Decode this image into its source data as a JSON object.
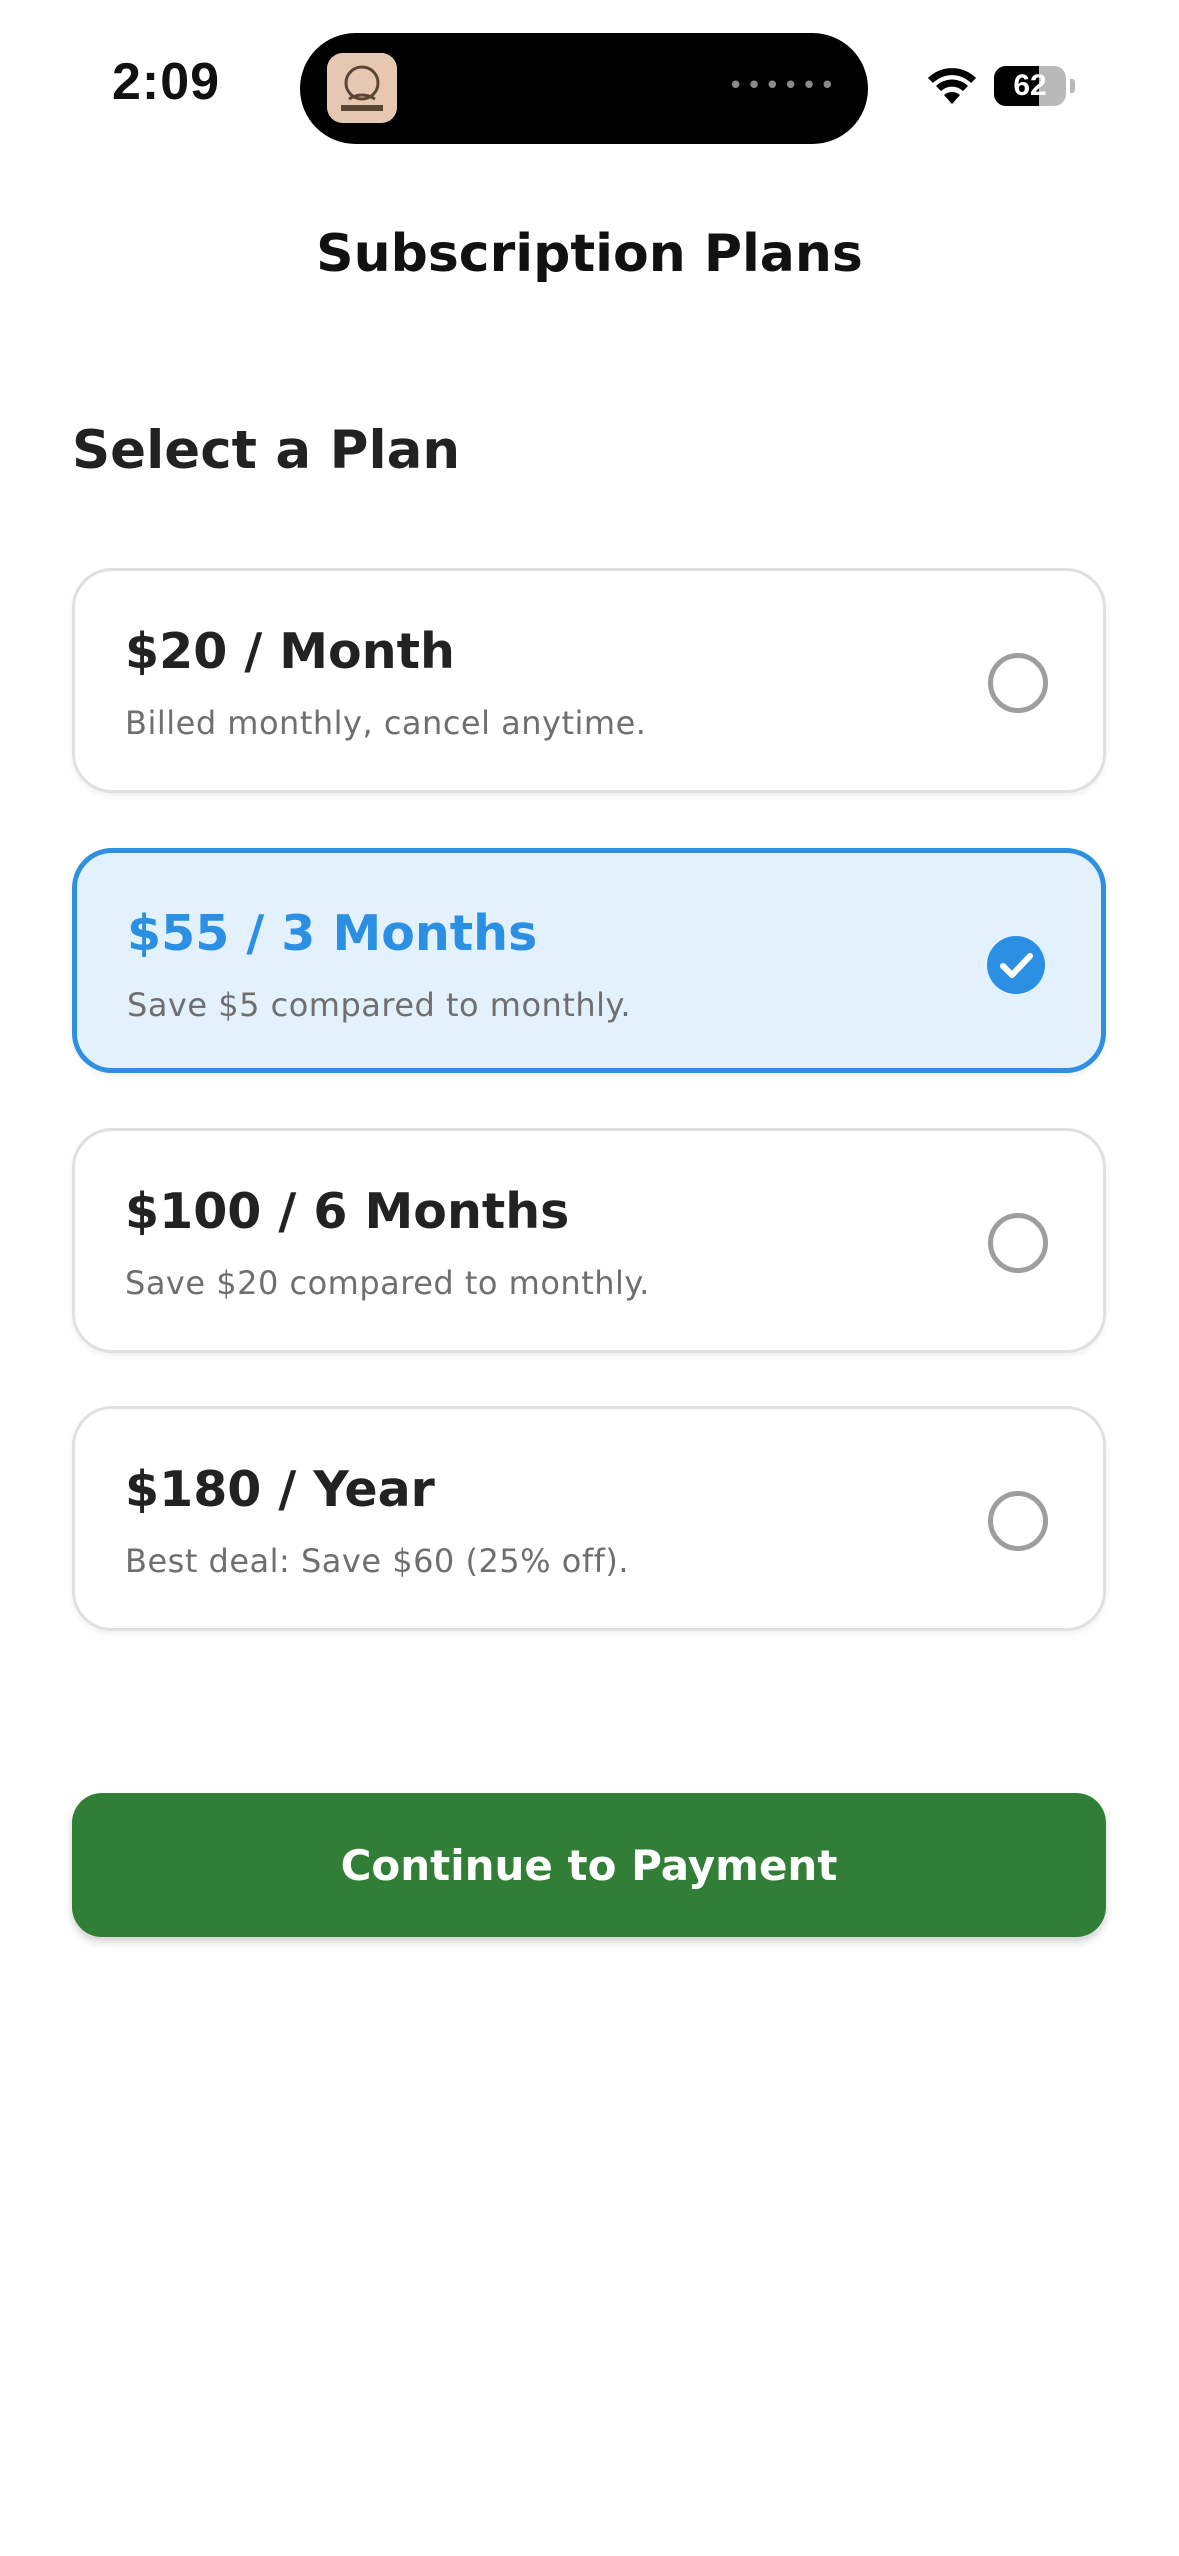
{
  "status_bar": {
    "time": "2:09",
    "battery_level": "62",
    "battery_fraction": 0.62,
    "icons": [
      "app-icon",
      "wifi-icon",
      "battery-icon"
    ]
  },
  "header": {
    "title": "Subscription Plans"
  },
  "section": {
    "title": "Select a Plan"
  },
  "plans": [
    {
      "name": "$20 / Month",
      "description": "Billed monthly, cancel anytime.",
      "selected": false
    },
    {
      "name": "$55 / 3 Months",
      "description": "Save $5 compared to monthly.",
      "selected": true
    },
    {
      "name": "$100 / 6 Months",
      "description": "Save $20 compared to monthly.",
      "selected": false
    },
    {
      "name": "$180 / Year",
      "description": "Best deal: Save $60 (25% off).",
      "selected": false
    }
  ],
  "actions": {
    "continue_label": "Continue to Payment"
  },
  "colors": {
    "accent": "#2b8fe3",
    "selected_bg": "#e3f1fc",
    "button": "#317e36",
    "radio_unchecked": "#9e9e9e"
  }
}
